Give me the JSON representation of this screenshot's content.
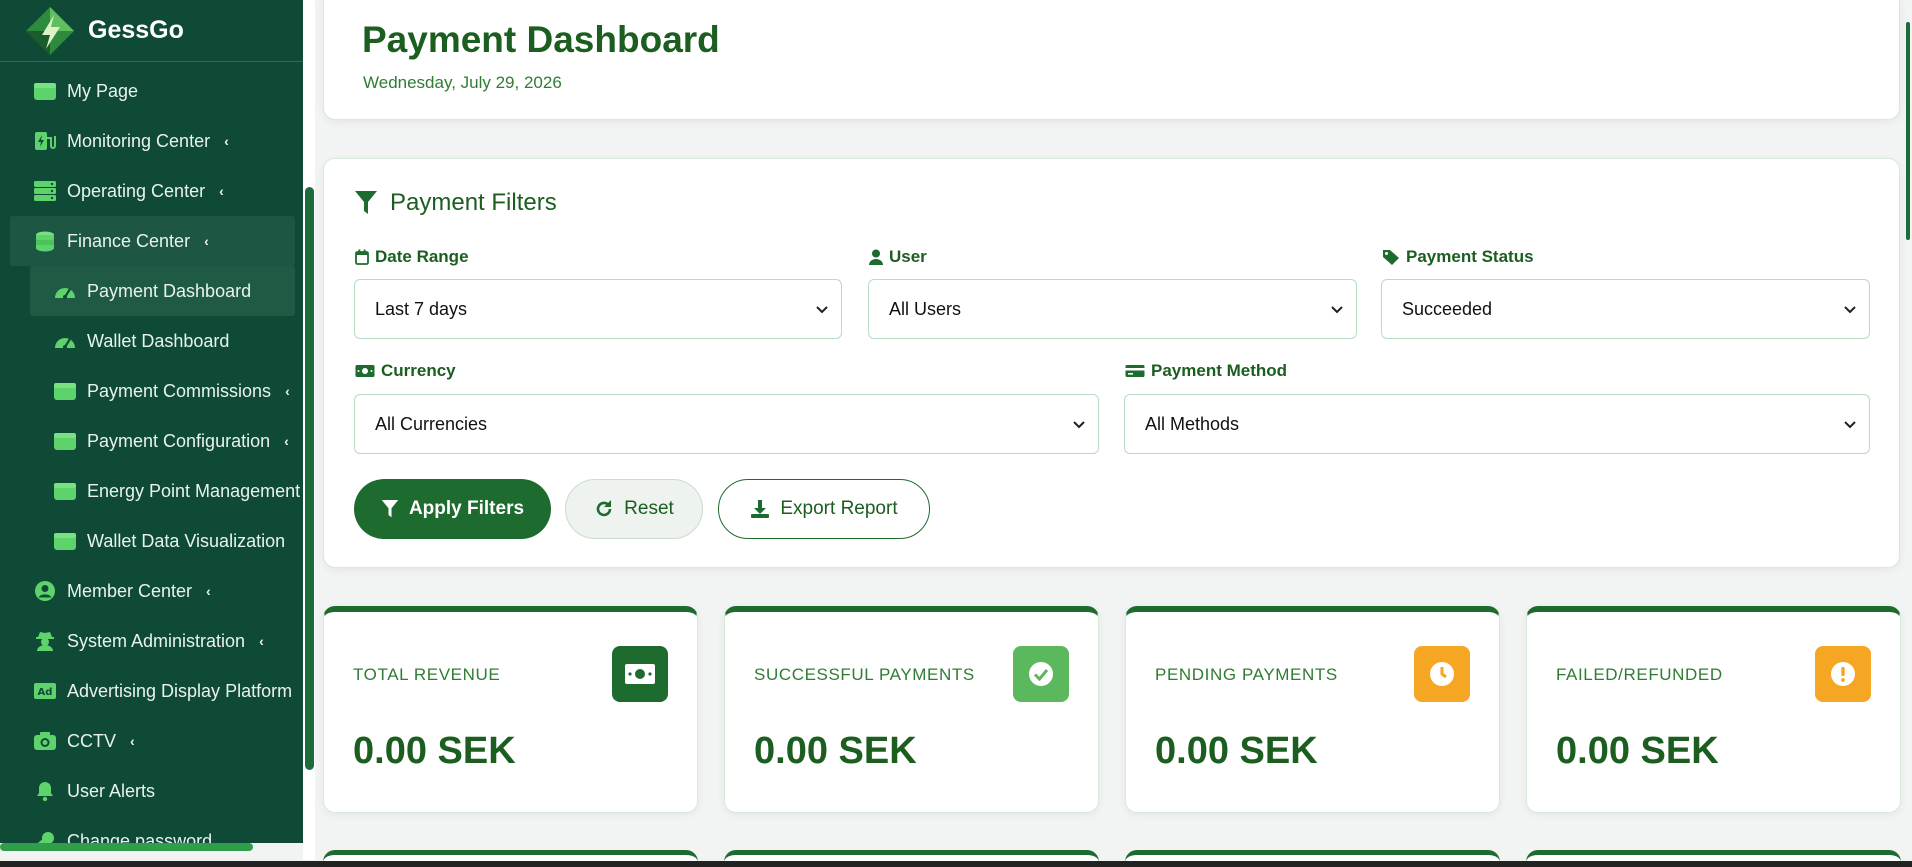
{
  "brand": {
    "name": "GessGo"
  },
  "sidebar": {
    "items": [
      {
        "label": "My Page",
        "icon": "wallet-icon",
        "chevron": ""
      },
      {
        "label": "Monitoring Center",
        "icon": "charging-station-icon",
        "chevron": "‹"
      },
      {
        "label": "Operating Center",
        "icon": "server-icon",
        "chevron": "‹"
      },
      {
        "label": "Finance Center",
        "icon": "coins-icon",
        "chevron": "‹"
      },
      {
        "label": "Payment Dashboard",
        "icon": "gauge-icon",
        "chevron": ""
      },
      {
        "label": "Wallet Dashboard",
        "icon": "gauge-icon",
        "chevron": ""
      },
      {
        "label": "Payment Commissions",
        "icon": "wallet-icon",
        "chevron": "‹"
      },
      {
        "label": "Payment Configuration",
        "icon": "wallet-icon",
        "chevron": "‹"
      },
      {
        "label": "Energy Point Management",
        "icon": "wallet-icon",
        "chevron": ""
      },
      {
        "label": "Wallet Data Visualization",
        "icon": "wallet-icon",
        "chevron": ""
      },
      {
        "label": "Member Center",
        "icon": "user-circle-icon",
        "chevron": "‹"
      },
      {
        "label": "System Administration",
        "icon": "user-secret-icon",
        "chevron": "‹"
      },
      {
        "label": "Advertising Display Platform",
        "icon": "ad-icon",
        "chevron": ""
      },
      {
        "label": "CCTV",
        "icon": "camera-icon",
        "chevron": "‹"
      },
      {
        "label": "User Alerts",
        "icon": "bell-icon",
        "chevron": ""
      },
      {
        "label": "Change password",
        "icon": "key-icon",
        "chevron": ""
      }
    ]
  },
  "header": {
    "title": "Payment Dashboard",
    "date": "Wednesday, July 29, 2026"
  },
  "filters": {
    "title": "Payment Filters",
    "date_range": {
      "label": "Date Range",
      "value": "Last 7 days"
    },
    "user": {
      "label": "User",
      "value": "All Users"
    },
    "status": {
      "label": "Payment Status",
      "value": "Succeeded"
    },
    "currency": {
      "label": "Currency",
      "value": "All Currencies"
    },
    "method": {
      "label": "Payment Method",
      "value": "All Methods"
    },
    "apply_label": "Apply Filters",
    "reset_label": "Reset",
    "export_label": "Export Report"
  },
  "stats": [
    {
      "label": "TOTAL REVENUE",
      "value": "0.00 SEK",
      "icon": "money-bill-icon",
      "color": "#1e6b2f"
    },
    {
      "label": "SUCCESSFUL PAYMENTS",
      "value": "0.00 SEK",
      "icon": "check-circle-icon",
      "color": "#5cb85c"
    },
    {
      "label": "PENDING PAYMENTS",
      "value": "0.00 SEK",
      "icon": "clock-icon",
      "color": "#f5a623"
    },
    {
      "label": "FAILED/REFUNDED",
      "value": "0.00 SEK",
      "icon": "exclamation-circle-icon",
      "color": "#f5a623"
    }
  ],
  "colors": {
    "sidebar_bg": "#0f4a36",
    "accent": "#1e6b2f",
    "icon_green": "#5fd36b"
  }
}
